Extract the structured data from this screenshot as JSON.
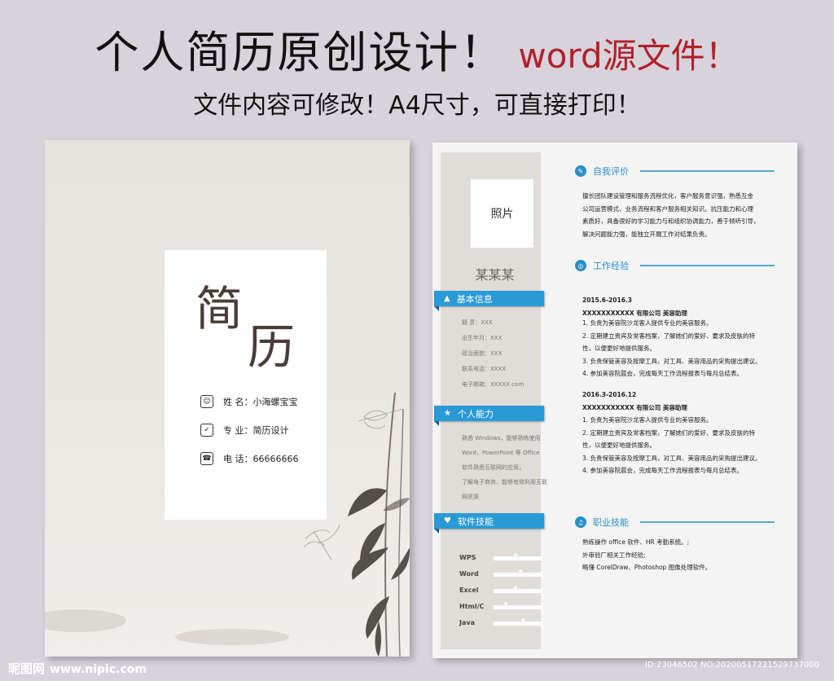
{
  "banner": {
    "title": "个人简历原创设计！",
    "accent": "word源文件！",
    "subtitle": "文件内容可修改！A4尺寸，可直接打印！"
  },
  "cover": {
    "char1": "简",
    "char2": "历",
    "rows": [
      {
        "icon": "person-icon",
        "label": "姓  名",
        "value": "小海螺宝宝"
      },
      {
        "icon": "thumb-icon",
        "label": "专  业",
        "value": "简历设计"
      },
      {
        "icon": "phone-icon",
        "label": "电  话",
        "value": "66666666"
      }
    ]
  },
  "resume": {
    "photo_label": "照片",
    "name": "某某某",
    "basic": {
      "title": "基本信息",
      "rows": [
        "籍    贯：XXX",
        "出生年月：XXX",
        "政治面貌：XXX",
        "联系电话：XXXX",
        "电子邮箱：XXXXX·com"
      ]
    },
    "ability": {
      "title": "个人能力",
      "rows": [
        "熟悉 Windows，能够熟练使用",
        "Word，PowerPoint 等 Office",
        "软件熟悉互联网的应用，",
        "了解电子商务，能够有效利用互联",
        "网资源"
      ]
    },
    "software": {
      "title": "软件技能",
      "skills": [
        {
          "name": "WPS",
          "level": 0.45
        },
        {
          "name": "Word",
          "level": 0.55
        },
        {
          "name": "Excel",
          "level": 0.45
        },
        {
          "name": "Html/C",
          "level": 0.25
        },
        {
          "name": "Java",
          "level": 0.6
        }
      ]
    },
    "self_eval": {
      "title": "自我评价",
      "lines": [
        "擅长团队建设管理和服务流程优化，客户服务意识强，熟悉互金",
        "公司运营模式、业务流程和客户服务相关知识。抗压能力和心理",
        "素质好，具备很好的学习能力与和组织协调能力，善于倾听引导，",
        "解决问题能力强，能独立开展工作对结果负责。"
      ]
    },
    "work": {
      "title": "工作经验",
      "jobs": [
        {
          "period": "2015.6-2016.3",
          "company": "XXXXXXXXXXX 有限公司       美容助理",
          "duties": [
            "1. 负责为美容院沙龙客人提供专业的美容服务。",
            "2. 定期建立贵宾及常客档案，了解她们的爱好、要求及皮肤的特",
            "性，以便更好地提供服务。",
            "3. 负责保管美容及按摩工具，对工具、美容用品的采购提出建议。",
            "4. 参加美容院晨会，完成每天工作流程报表与每月总结表。"
          ]
        },
        {
          "period": "2016.3-2016.12",
          "company": "XXXXXXXXXXX 有限公司       美容助理",
          "duties": [
            "1. 负责为美容院沙龙客人提供专业的美容服务。",
            "2. 定期建立贵宾及常客档案，了解她们的爱好、要求及皮肤的特",
            "性，以便更好地提供服务。",
            "3. 负责保管美容及按摩工具，对工具、美容用品的采购提出建议。",
            "4. 参加美容院晨会，完成每天工作流程报表与每月总结表。"
          ]
        }
      ]
    },
    "skills": {
      "title": "职业技能",
      "lines": [
        "熟练操作 office 软件、HR 考勤系统。;",
        "外审验厂相关工作经验;",
        "略懂 CorelDraw、Photoshop 图像处理软件。"
      ]
    }
  },
  "watermark": {
    "brand": "昵图网",
    "site": "www.nipic.com",
    "id_text": "ID:23046502 NO:20200517221529737000"
  },
  "colors": {
    "accent": "#2a9ad6",
    "banner_red": "#b0222a"
  }
}
